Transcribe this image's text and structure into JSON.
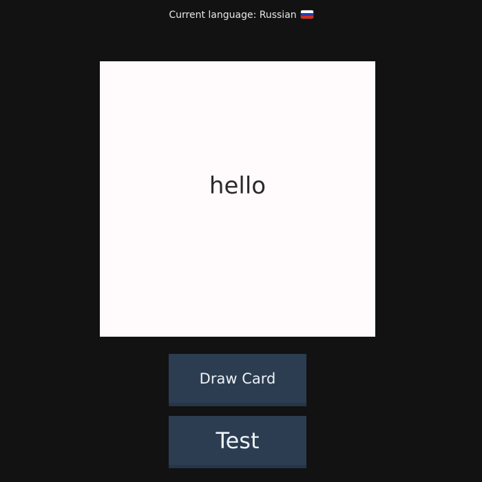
{
  "header": {
    "language_label": "Current language: Russian",
    "flag_icon": "russia-flag-icon",
    "flag_colors": [
      "#ffffff",
      "#1c3fb8",
      "#d52b1e"
    ]
  },
  "card": {
    "text": "hello",
    "background": "#fffafb"
  },
  "buttons": {
    "draw_card_label": "Draw Card",
    "test_label": "Test",
    "color": "#2c3d52"
  },
  "theme": {
    "background": "#121212"
  }
}
